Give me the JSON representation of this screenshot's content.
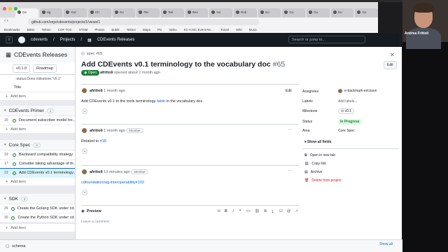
{
  "browser": {
    "tabs": [
      "Ge",
      "sig",
      "Gor",
      "Ch",
      "Go",
      "Ple",
      "Tek",
      "Rev",
      "Iss",
      "Rob",
      "Go",
      "Go",
      "Go",
      "Go",
      "Go"
    ],
    "url": "github.com/orgs/cdevents/projects/1/views/1",
    "bookmarks": [
      "Bookmarks",
      "BBtm",
      "Tekton",
      "COF TOC",
      "STSM",
      "Photos",
      "Bublk",
      "Tekton",
      "Maps",
      "Pis",
      "Video",
      "KC+CNC Event Re...",
      "Travel",
      "Wiki",
      "Music"
    ]
  },
  "github": {
    "breadcrumb": {
      "org": "cdevents",
      "projects": "Projects",
      "project": "CDEvents Releases"
    },
    "search_placeholder": "Search or jump to..."
  },
  "project": {
    "title": "CDEvents Releases",
    "view_label": "v0.1.0",
    "roadmap_label": "Roadmap",
    "filter": "-status:Done milestone:\"v0.1\"",
    "title_col": "Title",
    "add_item": "Add item",
    "groups": [
      {
        "name": "CDEvents Primer",
        "count": "1",
        "rows": [
          {
            "num": "15",
            "title": "Document subscriber model for..."
          }
        ]
      },
      {
        "name": "Core Spec",
        "count": "3",
        "rows": [
          {
            "num": "19",
            "title": "Backward compatibility strategy"
          },
          {
            "num": "17",
            "title": "Consider taking advantage of th..."
          },
          {
            "num": "23",
            "title": "Add CDEvents v0.1 terminology..."
          }
        ]
      },
      {
        "name": "SDK",
        "count": "2",
        "rows": [
          {
            "num": "29",
            "title": "Create the Golang SDK under cd..."
          },
          {
            "num": "30",
            "title": "Create the Python SDK under cd..."
          }
        ]
      }
    ]
  },
  "issue": {
    "repo": "spec #65",
    "title": "Add CDEvents v0.1 terminology to the vocabulary doc",
    "number": "#65",
    "edit": "Edit",
    "state": "Open",
    "author": "afrittoli",
    "opened": "opened about 1 month ago",
    "comments": [
      {
        "author": "afrittoli",
        "time": "1 month ago",
        "body_pre": "Add CDEvents v0.1 to the tools terminology",
        "body_link": "table",
        "body_post": "in the vocabulary doc.",
        "edit": "Edit"
      },
      {
        "author": "afrittoli",
        "time": "1 month ago",
        "badge": "Member",
        "body_pre": "Related to",
        "body_link": "#18"
      },
      {
        "author": "afrittoli",
        "time": "13 minutes ago",
        "badge": "Member",
        "body_link": "cdfoundation/sig-interoperability#103"
      }
    ],
    "composer": {
      "preview": "Preview",
      "placeholder": "Leave a comment"
    }
  },
  "sidebar": {
    "assignees_label": "Assignees",
    "assignee": "e-backmark-ericsson",
    "labels_label": "Labels",
    "labels_value": "Add labels...",
    "milestone_label": "Milestone",
    "milestone_value": "v0.1",
    "status_label": "Status",
    "status_value": "In Progress",
    "area_label": "Area",
    "area_value": "Core Spec",
    "show_all": "Show all fields",
    "actions": [
      "Open in new tab",
      "Copy link",
      "Archive",
      "Delete from project"
    ]
  },
  "bottom": {
    "file": "schema",
    "show_all": "Show all"
  },
  "video": {
    "name": "Andrea Frittoli"
  }
}
